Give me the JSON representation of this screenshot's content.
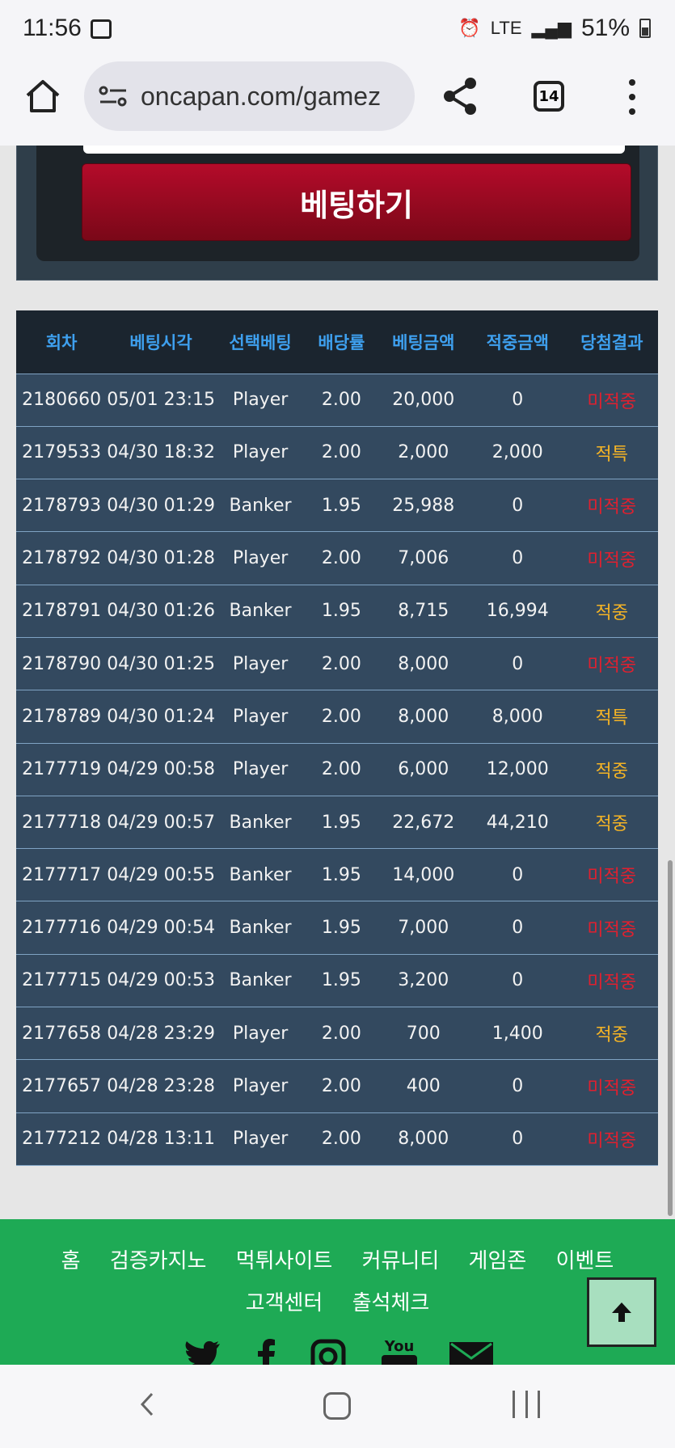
{
  "status_bar": {
    "time": "11:56",
    "network": "LTE",
    "battery": "51%"
  },
  "browser": {
    "url": "oncapan.com/gamez",
    "tab_count": "14"
  },
  "bet_button_label": "베팅하기",
  "table": {
    "headers": [
      "회차",
      "베팅시각",
      "선택베팅",
      "배당률",
      "베팅금액",
      "적중금액",
      "당첨결과"
    ],
    "rows": [
      [
        "2180660",
        "05/01 23:15",
        "Player",
        "2.00",
        "20,000",
        "0",
        "미적중"
      ],
      [
        "2179533",
        "04/30 18:32",
        "Player",
        "2.00",
        "2,000",
        "2,000",
        "적특"
      ],
      [
        "2178793",
        "04/30 01:29",
        "Banker",
        "1.95",
        "25,988",
        "0",
        "미적중"
      ],
      [
        "2178792",
        "04/30 01:28",
        "Player",
        "2.00",
        "7,006",
        "0",
        "미적중"
      ],
      [
        "2178791",
        "04/30 01:26",
        "Banker",
        "1.95",
        "8,715",
        "16,994",
        "적중"
      ],
      [
        "2178790",
        "04/30 01:25",
        "Player",
        "2.00",
        "8,000",
        "0",
        "미적중"
      ],
      [
        "2178789",
        "04/30 01:24",
        "Player",
        "2.00",
        "8,000",
        "8,000",
        "적특"
      ],
      [
        "2177719",
        "04/29 00:58",
        "Player",
        "2.00",
        "6,000",
        "12,000",
        "적중"
      ],
      [
        "2177718",
        "04/29 00:57",
        "Banker",
        "1.95",
        "22,672",
        "44,210",
        "적중"
      ],
      [
        "2177717",
        "04/29 00:55",
        "Banker",
        "1.95",
        "14,000",
        "0",
        "미적중"
      ],
      [
        "2177716",
        "04/29 00:54",
        "Banker",
        "1.95",
        "7,000",
        "0",
        "미적중"
      ],
      [
        "2177715",
        "04/29 00:53",
        "Banker",
        "1.95",
        "3,200",
        "0",
        "미적중"
      ],
      [
        "2177658",
        "04/28 23:29",
        "Player",
        "2.00",
        "700",
        "1,400",
        "적중"
      ],
      [
        "2177657",
        "04/28 23:28",
        "Player",
        "2.00",
        "400",
        "0",
        "미적중"
      ],
      [
        "2177212",
        "04/28 13:11",
        "Player",
        "2.00",
        "8,000",
        "0",
        "미적중"
      ]
    ]
  },
  "footer": {
    "nav": [
      "홈",
      "검증카지노",
      "먹튀사이트",
      "커뮤니티",
      "게임존",
      "이벤트",
      "고객센터",
      "출석체크"
    ],
    "social_icons": [
      "twitter-icon",
      "facebook-icon",
      "instagram-icon",
      "youtube-icon",
      "mail-icon"
    ],
    "youtube_text": "You"
  },
  "colors": {
    "win": "#f5b425",
    "lose": "#e0202f",
    "header_text": "#3ea0ef",
    "footer_bg": "#1eaa55"
  }
}
